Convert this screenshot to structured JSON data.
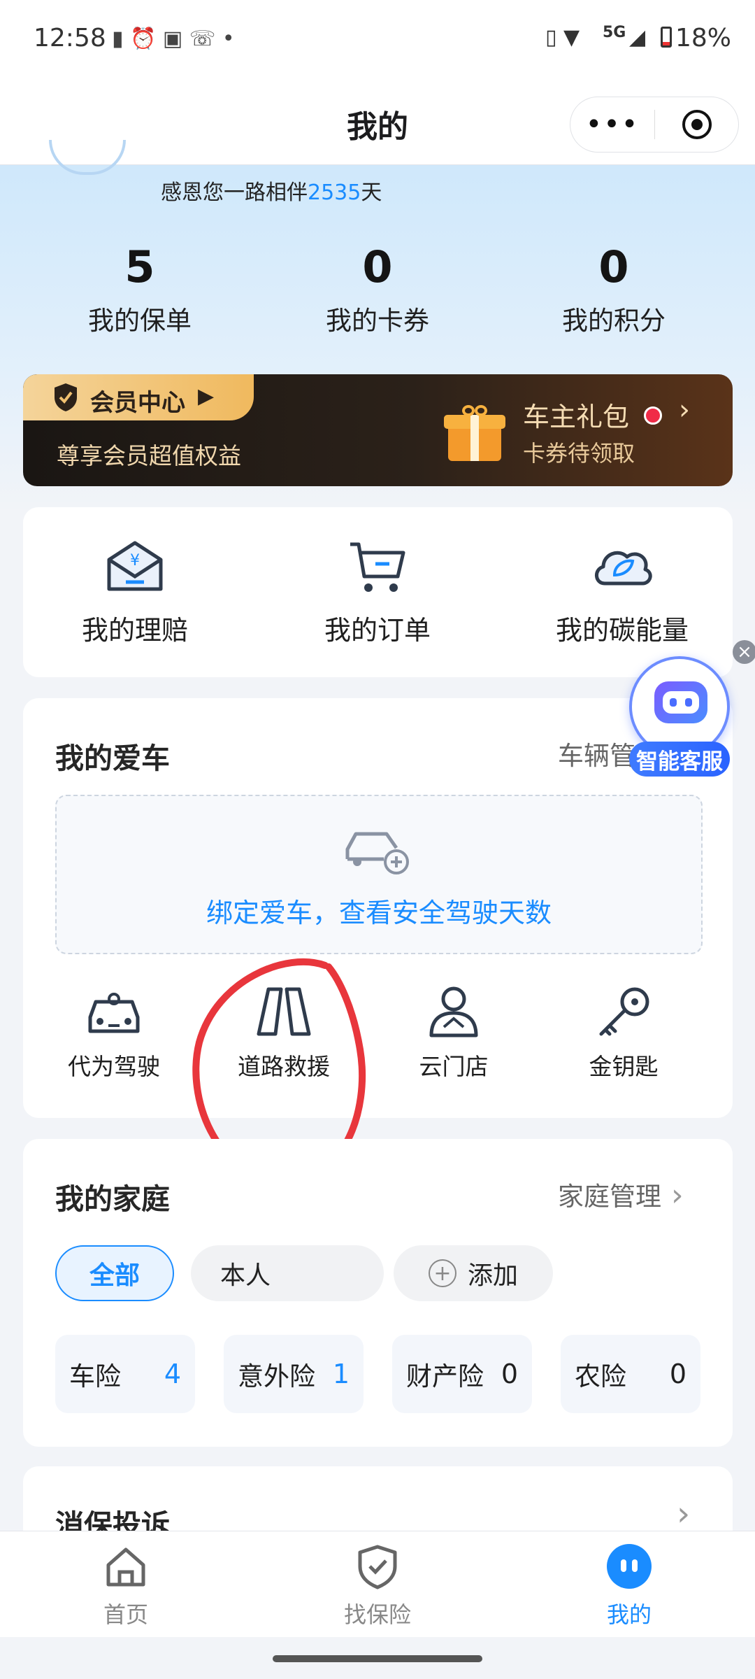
{
  "status_bar": {
    "time": "12:58",
    "network": "5G",
    "battery": "18%"
  },
  "title_bar": {
    "title": "我的"
  },
  "profile": {
    "thanks_prefix": "感恩您一路相伴",
    "days": "2535",
    "days_suffix": "天"
  },
  "stats": [
    {
      "value": "5",
      "label": "我的保单"
    },
    {
      "value": "0",
      "label": "我的卡券"
    },
    {
      "value": "0",
      "label": "我的积分"
    }
  ],
  "member_banner": {
    "title": "会员中心",
    "subtitle": "尊享会员超值权益",
    "gift_title": "车主礼包",
    "gift_subtitle": "卡券待领取"
  },
  "quick_actions": [
    {
      "label": "我的理赔",
      "icon": "envelope-yen-icon"
    },
    {
      "label": "我的订单",
      "icon": "cart-icon"
    },
    {
      "label": "我的碳能量",
      "icon": "cloud-leaf-icon"
    }
  ],
  "my_car": {
    "title": "我的爱车",
    "manage_label": "车辆管",
    "bind_prompt": "绑定爱车，查看安全驾驶天数",
    "services": [
      {
        "label": "代为驾驶",
        "icon": "car-driver-icon"
      },
      {
        "label": "道路救援",
        "icon": "road-rescue-icon"
      },
      {
        "label": "云门店",
        "icon": "person-icon"
      },
      {
        "label": "金钥匙",
        "icon": "key-icon"
      }
    ]
  },
  "assistant": {
    "label": "智能客服"
  },
  "family": {
    "title": "我的家庭",
    "manage_label": "家庭管理",
    "filters": [
      {
        "label": "全部",
        "active": true
      },
      {
        "label": "本人",
        "active": false
      }
    ],
    "add_label": "添加",
    "insurances": [
      {
        "name": "车险",
        "count": "4"
      },
      {
        "name": "意外险",
        "count": "1"
      },
      {
        "name": "财产险",
        "count": "0"
      },
      {
        "name": "农险",
        "count": "0"
      }
    ]
  },
  "complaint": {
    "title": "消保投诉"
  },
  "tab_bar": [
    {
      "label": "首页",
      "active": false
    },
    {
      "label": "找保险",
      "active": false
    },
    {
      "label": "我的",
      "active": true
    }
  ],
  "colors": {
    "accent": "#1a8cff",
    "gold": "#f3c16a",
    "annotation": "#e8363c"
  }
}
